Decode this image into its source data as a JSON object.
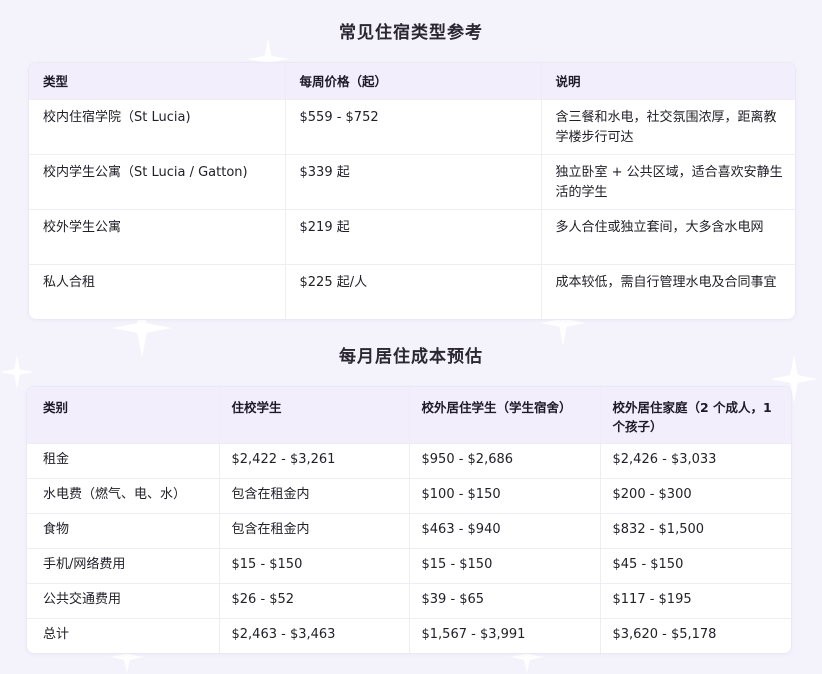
{
  "housing": {
    "title": "常见住宿类型参考",
    "headers": [
      "类型",
      "每周价格（起）",
      "说明"
    ],
    "rows": [
      [
        "校内住宿学院（St Lucia)",
        "$559 - $752",
        "含三餐和水电，社交氛围浓厚，距离教学楼步行可达"
      ],
      [
        "校内学生公寓（St Lucia / Gatton)",
        "$339 起",
        "独立卧室 + 公共区域，适合喜欢安静生活的学生"
      ],
      [
        "校外学生公寓",
        "$219 起",
        "多人合住或独立套间，大多含水电网"
      ],
      [
        "私人合租",
        "$225 起/人",
        "成本较低，需自行管理水电及合同事宜"
      ]
    ]
  },
  "costs": {
    "title": "每月居住成本预估",
    "headers": [
      "类别",
      "住校学生",
      "校外居住学生（学生宿舍）",
      "校外居住家庭（2 个成人，1 个孩子）"
    ],
    "rows": [
      [
        "租金",
        "$2,422 - $3,261",
        "$950 - $2,686",
        "$2,426 - $3,033"
      ],
      [
        "水电费（燃气、电、水）",
        "包含在租金内",
        "$100 - $150",
        "$200 - $300"
      ],
      [
        "食物",
        "包含在租金内",
        "$463 - $940",
        "$832 - $1,500"
      ],
      [
        "手机/网络费用",
        "$15 - $150",
        "$15 - $150",
        "$45 - $150"
      ],
      [
        "公共交通费用",
        "$26 - $52",
        "$39 - $65",
        "$117 - $195"
      ],
      [
        "总计",
        "$2,463 - $3,463",
        "$1,567 - $3,991",
        "$3,620 - $5,178"
      ]
    ]
  }
}
